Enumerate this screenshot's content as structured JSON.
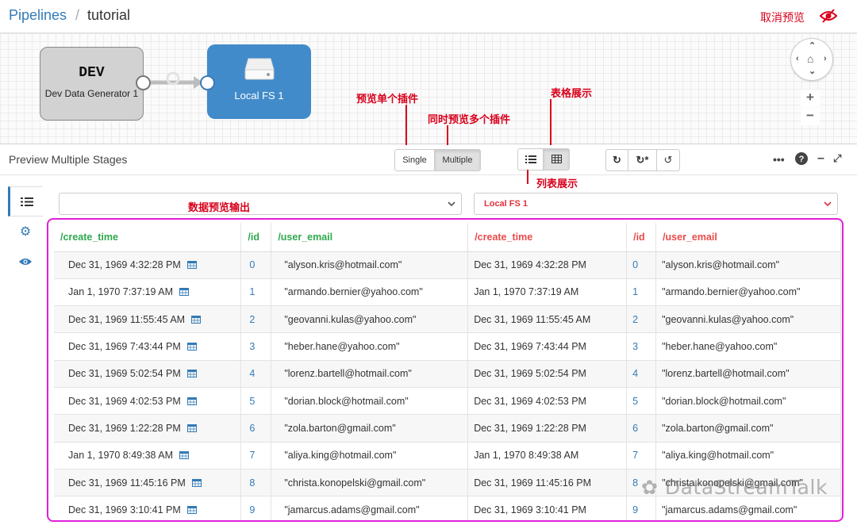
{
  "header": {
    "breadcrumb_root": "Pipelines",
    "breadcrumb_sep": "/",
    "pipeline_name": "tutorial",
    "cancel_preview": "取消预览"
  },
  "canvas": {
    "dev_node": {
      "title": "DEV",
      "label": "Dev Data Generator 1"
    },
    "fs_node": {
      "label": "Local FS 1"
    }
  },
  "annotations": {
    "single_plugin": "预览单个插件",
    "multi_plugin": "同时预览多个插件",
    "table_view": "表格展示",
    "list_view": "列表展示",
    "output": "数据预览输出"
  },
  "preview": {
    "title": "Preview Multiple Stages",
    "mode_single": "Single",
    "mode_multiple": "Multiple",
    "right_stage_select": "Local FS 1"
  },
  "table": {
    "headers": [
      "/create_time",
      "/id",
      "/user_email",
      "/create_time",
      "/id",
      "/user_email"
    ],
    "rows": [
      [
        "Dec 31, 1969 4:32:28 PM",
        "0",
        "\"alyson.kris@hotmail.com\""
      ],
      [
        "Jan 1, 1970 7:37:19 AM",
        "1",
        "\"armando.bernier@yahoo.com\""
      ],
      [
        "Dec 31, 1969 11:55:45 AM",
        "2",
        "\"geovanni.kulas@yahoo.com\""
      ],
      [
        "Dec 31, 1969 7:43:44 PM",
        "3",
        "\"heber.hane@yahoo.com\""
      ],
      [
        "Dec 31, 1969 5:02:54 PM",
        "4",
        "\"lorenz.bartell@hotmail.com\""
      ],
      [
        "Dec 31, 1969 4:02:53 PM",
        "5",
        "\"dorian.block@hotmail.com\""
      ],
      [
        "Dec 31, 1969 1:22:28 PM",
        "6",
        "\"zola.barton@gmail.com\""
      ],
      [
        "Jan 1, 1970 8:49:38 AM",
        "7",
        "\"aliya.king@hotmail.com\""
      ],
      [
        "Dec 31, 1969 11:45:16 PM",
        "8",
        "\"christa.konopelski@gmail.com\""
      ],
      [
        "Dec 31, 1969 3:10:41 PM",
        "9",
        "\"jamarcus.adams@gmail.com\""
      ]
    ]
  },
  "watermark": "DataStreamTalk",
  "colors": {
    "link": "#337ab7",
    "annotation": "#d9001b",
    "highlight_border": "#e020d8",
    "left_header": "#2fa84f",
    "right_header": "#e84b4b"
  }
}
